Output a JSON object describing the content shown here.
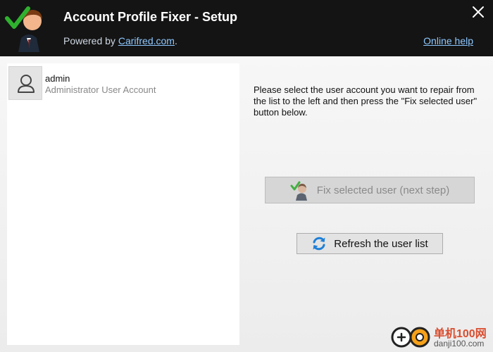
{
  "header": {
    "title": "Account Profile Fixer - Setup",
    "powered_prefix": "Powered by ",
    "powered_link": "Carifred.com",
    "powered_suffix": ".",
    "online_help": "Online help"
  },
  "user_list": [
    {
      "name": "admin",
      "description": "Administrator User Account"
    }
  ],
  "instructions": "Please select the user account you want to repair from the list to the left and then press the \"Fix selected user\" button below.",
  "buttons": {
    "fix": {
      "label": "Fix selected user (next step)",
      "enabled": false
    },
    "refresh": {
      "label": "Refresh the user list"
    }
  },
  "watermark": {
    "name": "单机100网",
    "url": "danji100.com"
  },
  "icons": {
    "app": "user-check-icon",
    "close": "close-icon",
    "avatar": "user-icon",
    "fix": "user-check-icon",
    "refresh": "refresh-icon"
  },
  "colors": {
    "header_bg": "#141414",
    "link": "#8ec8ff",
    "check_green": "#2fb12f",
    "refresh_blue": "#1e7fd6"
  }
}
